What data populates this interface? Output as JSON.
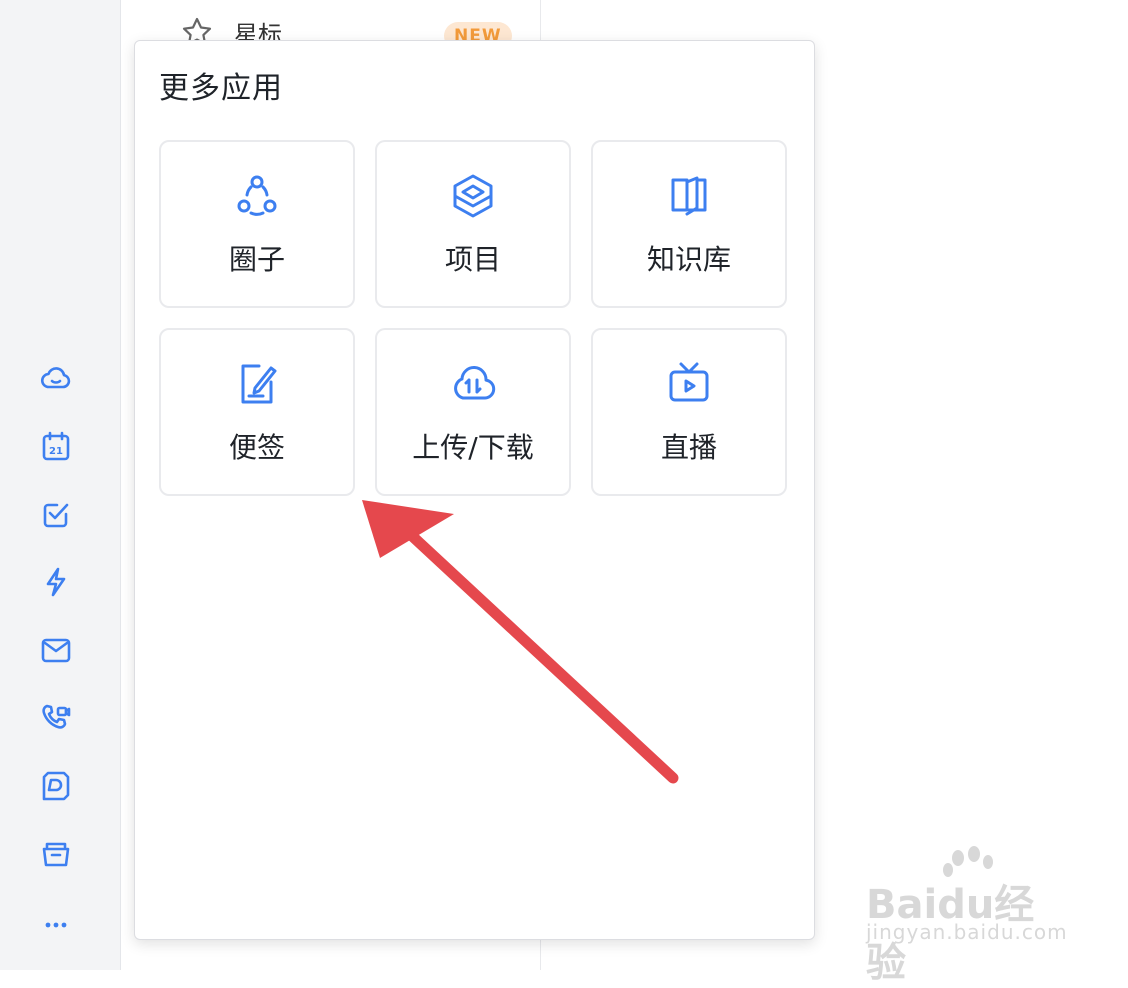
{
  "sidebar": {
    "icons": [
      "cloud-icon",
      "calendar-icon",
      "todo-check-icon",
      "lightning-icon",
      "mail-icon",
      "video-call-icon",
      "docs-icon",
      "folder-icon",
      "more-dots-icon"
    ],
    "calendar_day": "21"
  },
  "list": {
    "star_label": "星标",
    "new_badge": "NEW"
  },
  "popup": {
    "title": "更多应用",
    "apps": [
      {
        "label": "圈子",
        "icon": "circle-group-icon"
      },
      {
        "label": "项目",
        "icon": "project-layers-icon"
      },
      {
        "label": "知识库",
        "icon": "knowledge-book-icon"
      },
      {
        "label": "便签",
        "icon": "note-edit-icon"
      },
      {
        "label": "上传/下载",
        "icon": "cloud-transfer-icon"
      },
      {
        "label": "直播",
        "icon": "live-tv-icon"
      }
    ]
  },
  "annotation": {
    "arrow_color": "#e5484d"
  },
  "accent_color": "#3d7ff0",
  "watermark": {
    "brand": "Baidu经验",
    "url": "jingyan.baidu.com"
  }
}
